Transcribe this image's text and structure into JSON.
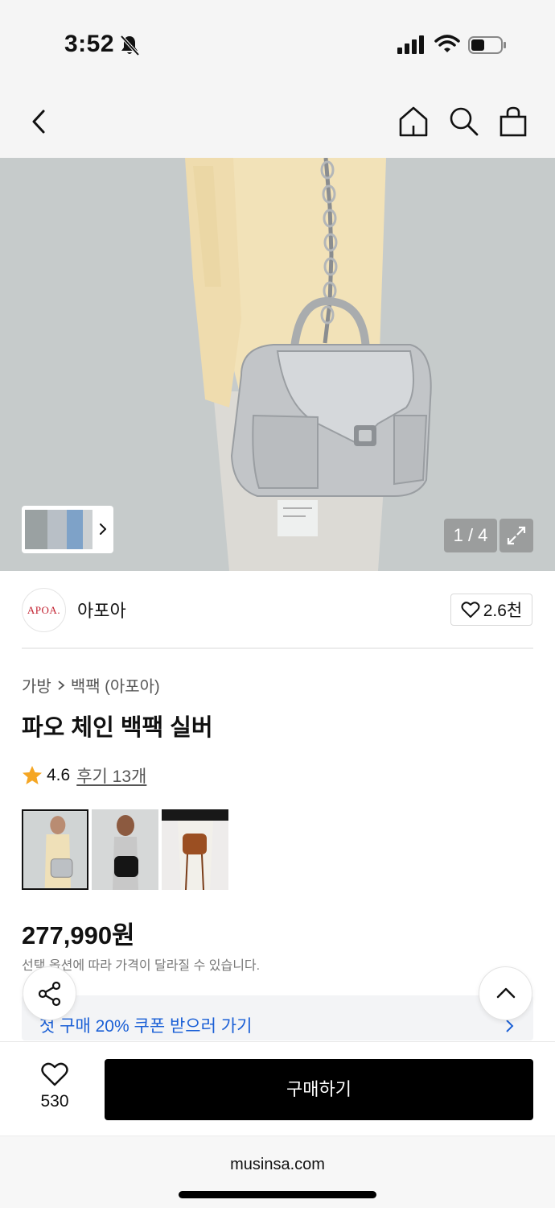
{
  "status_bar": {
    "time": "3:52",
    "icons": [
      "bell-slash-icon",
      "cellular-signal-icon",
      "wifi-icon",
      "battery-icon"
    ]
  },
  "nav": {
    "icons": [
      "back-chevron-icon",
      "home-icon",
      "search-icon",
      "shopping-bag-icon"
    ]
  },
  "gallery": {
    "counter": "1 / 4",
    "current": 1,
    "total": 4,
    "icons": [
      "expand-icon",
      "chevron-right-icon"
    ]
  },
  "brand": {
    "logo_text": "APOA.",
    "name": "아포아",
    "likes": "2.6천"
  },
  "product": {
    "breadcrumb": [
      "가방",
      "백팩 (아포아)"
    ],
    "title": "파오 체인 백팩 실버",
    "rating": "4.6",
    "reviews": "후기 13개",
    "color_options": [
      "silver",
      "black",
      "brown"
    ],
    "selected_color": "silver",
    "price": "277,990원",
    "price_note": "선택 옵션에 따라 가격이 달라질 수 있습니다."
  },
  "coupon": {
    "text": "첫 구매 20% 쿠폰 받으러 가기"
  },
  "bottom_bar": {
    "like_count": "530",
    "buy_label": "구매하기"
  },
  "browser": {
    "url": "musinsa.com"
  },
  "colors": {
    "accent_blue": "#1a5fd6",
    "star": "#f5a623",
    "brand_red": "#c2202f",
    "buy_bg": "#000000"
  }
}
